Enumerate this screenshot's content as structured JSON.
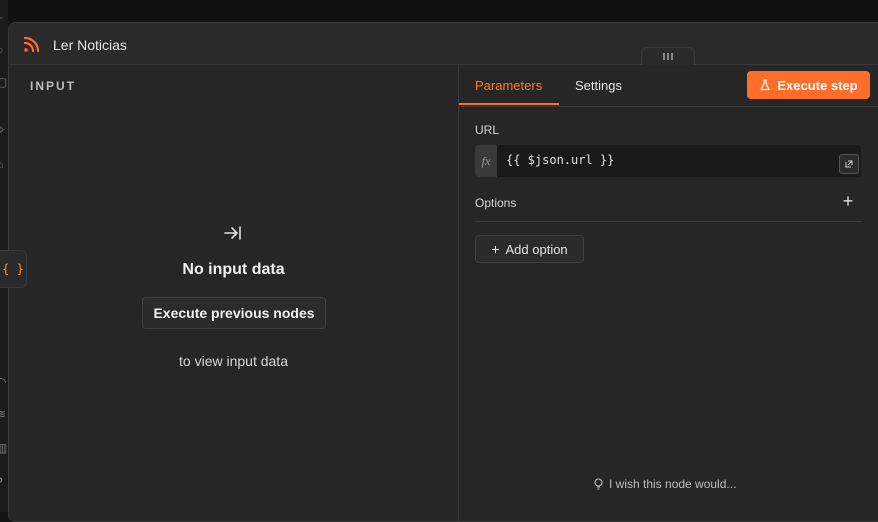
{
  "modal": {
    "title": "Ler Noticias",
    "title_icon": "rss-icon"
  },
  "input_pane": {
    "label": "INPUT",
    "empty_icon": "arrow-to-right-icon",
    "empty_title": "No input data",
    "execute_previous_label": "Execute previous nodes",
    "hint": "to view input data"
  },
  "param_pane": {
    "tabs": [
      {
        "label": "Parameters",
        "active": true
      },
      {
        "label": "Settings",
        "active": false
      }
    ],
    "execute_step_label": "Execute step",
    "url": {
      "label": "URL",
      "fx": "fx",
      "value": "{{ $json.url }}"
    },
    "options_label": "Options",
    "add_option_label": "Add option",
    "feedback_text": "I wish this node would..."
  },
  "side": {
    "json_button": "{ }"
  },
  "colors": {
    "accent": "#ff6d2b",
    "background": "#262626",
    "border": "#3a3a3a"
  }
}
